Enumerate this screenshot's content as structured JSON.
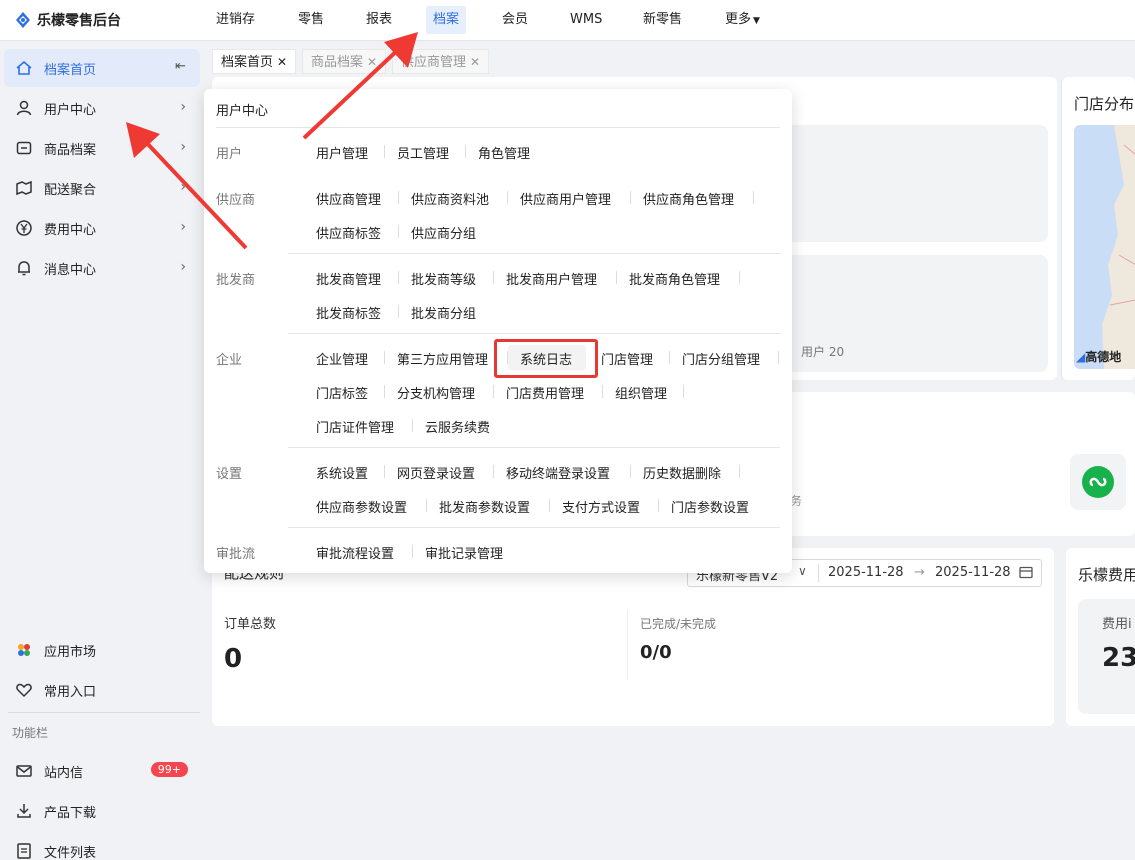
{
  "header": {
    "app_title": "乐檬零售后台",
    "nav": [
      "进销存",
      "零售",
      "报表",
      "档案",
      "会员",
      "WMS",
      "新零售",
      "更多"
    ],
    "active_nav": "档案"
  },
  "sidebar": {
    "items": [
      {
        "label": "档案首页",
        "icon": "home-icon"
      },
      {
        "label": "用户中心",
        "icon": "user-icon"
      },
      {
        "label": "商品档案",
        "icon": "box-icon"
      },
      {
        "label": "配送聚合",
        "icon": "delivery-icon"
      },
      {
        "label": "费用中心",
        "icon": "yen-icon"
      },
      {
        "label": "消息中心",
        "icon": "bell-icon"
      }
    ],
    "bottom_items": [
      {
        "label": "应用市场",
        "icon": "app-market-icon"
      },
      {
        "label": "常用入口",
        "icon": "heart-icon"
      }
    ],
    "func_label": "功能栏",
    "func_items": [
      {
        "label": "站内信",
        "icon": "mail-icon",
        "badge": "99+"
      },
      {
        "label": "产品下载",
        "icon": "download-icon"
      },
      {
        "label": "文件列表",
        "icon": "file-icon"
      }
    ]
  },
  "tabs": [
    "档案首页",
    "商品档案",
    "供应商管理"
  ],
  "menu": {
    "title": "用户中心",
    "groups": [
      {
        "category": "用户",
        "rows": [
          [
            "用户管理",
            "员工管理",
            "角色管理"
          ]
        ]
      },
      {
        "category": "供应商",
        "rows": [
          [
            "供应商管理",
            "供应商资料池",
            "供应商用户管理",
            "供应商角色管理"
          ],
          [
            "供应商标签",
            "供应商分组"
          ]
        ]
      },
      {
        "category": "批发商",
        "rows": [
          [
            "批发商管理",
            "批发商等级",
            "批发商用户管理",
            "批发商角色管理"
          ],
          [
            "批发商标签",
            "批发商分组"
          ]
        ]
      },
      {
        "category": "企业",
        "rows": [
          [
            "企业管理",
            "第三方应用管理",
            "系统日志",
            "门店管理",
            "门店分组管理"
          ],
          [
            "门店标签",
            "分支机构管理",
            "门店费用管理",
            "组织管理"
          ],
          [
            "门店证件管理",
            "云服务续费"
          ]
        ]
      },
      {
        "category": "设置",
        "rows": [
          [
            "系统设置",
            "网页登录设置",
            "移动终端登录设置",
            "历史数据删除"
          ],
          [
            "供应商参数设置",
            "批发商参数设置",
            "支付方式设置",
            "门店参数设置"
          ]
        ]
      },
      {
        "category": "审批流",
        "rows": [
          [
            "审批流程设置",
            "审批记录管理"
          ]
        ]
      }
    ],
    "highlighted": "系统日志"
  },
  "background": {
    "map_title": "门店分布",
    "map_badge": "高德地",
    "user_count": "用户 20",
    "partial_text": "务",
    "delivery_title": "配送规则",
    "store_select": "乐檬新零售V2",
    "date_start": "2025-11-28",
    "date_end": "2025-11-28",
    "order_total_label": "订单总数",
    "order_total_value": "0",
    "done_label": "已完成/未完成",
    "done_value": "0/0",
    "fee_title": "乐檬费用",
    "fee_sub": "费用i",
    "fee_value": "23"
  },
  "colors": {
    "accent": "#2f6fe0",
    "highlight": "#e53935",
    "badge": "#f5454e"
  }
}
